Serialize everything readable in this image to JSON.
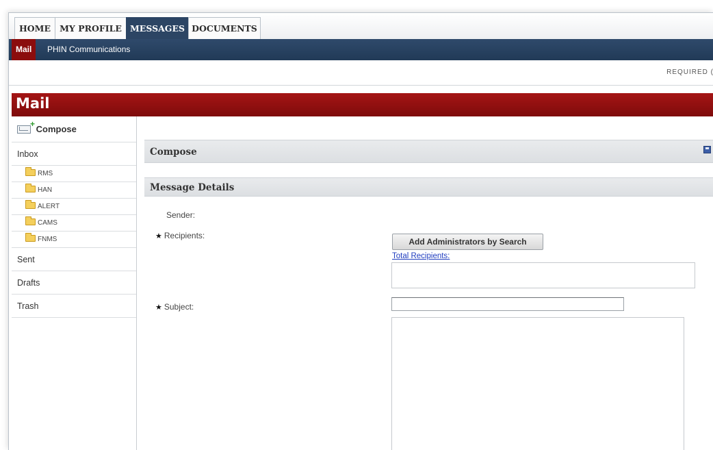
{
  "tabs": {
    "home": "HOME",
    "my_profile": "MY PROFILE",
    "messages": "MESSAGES",
    "documents": "DOCUMENTS"
  },
  "subnav": {
    "mail": "Mail",
    "phin": "PHIN Communications"
  },
  "required_note": "REQUIRED (",
  "mail_title": "Mail",
  "sidebar": {
    "compose": "Compose",
    "inbox": "Inbox",
    "folders": [
      "RMS",
      "HAN",
      "ALERT",
      "CAMS",
      "FNMS"
    ],
    "sent": "Sent",
    "drafts": "Drafts",
    "trash": "Trash"
  },
  "compose_header": "Compose",
  "details_header": "Message Details",
  "form": {
    "sender_label": "Sender:",
    "recipients_label": "Recipients:",
    "subject_label": "Subject:",
    "required_marker": "★",
    "add_admins_button": "Add Administrators by Search",
    "total_recipients_link": "Total Recipients:",
    "subject_value": ""
  },
  "colors": {
    "nav_blue": "#2c4564",
    "mail_red": "#8b0d0d",
    "link_blue": "#1f3dbf"
  }
}
